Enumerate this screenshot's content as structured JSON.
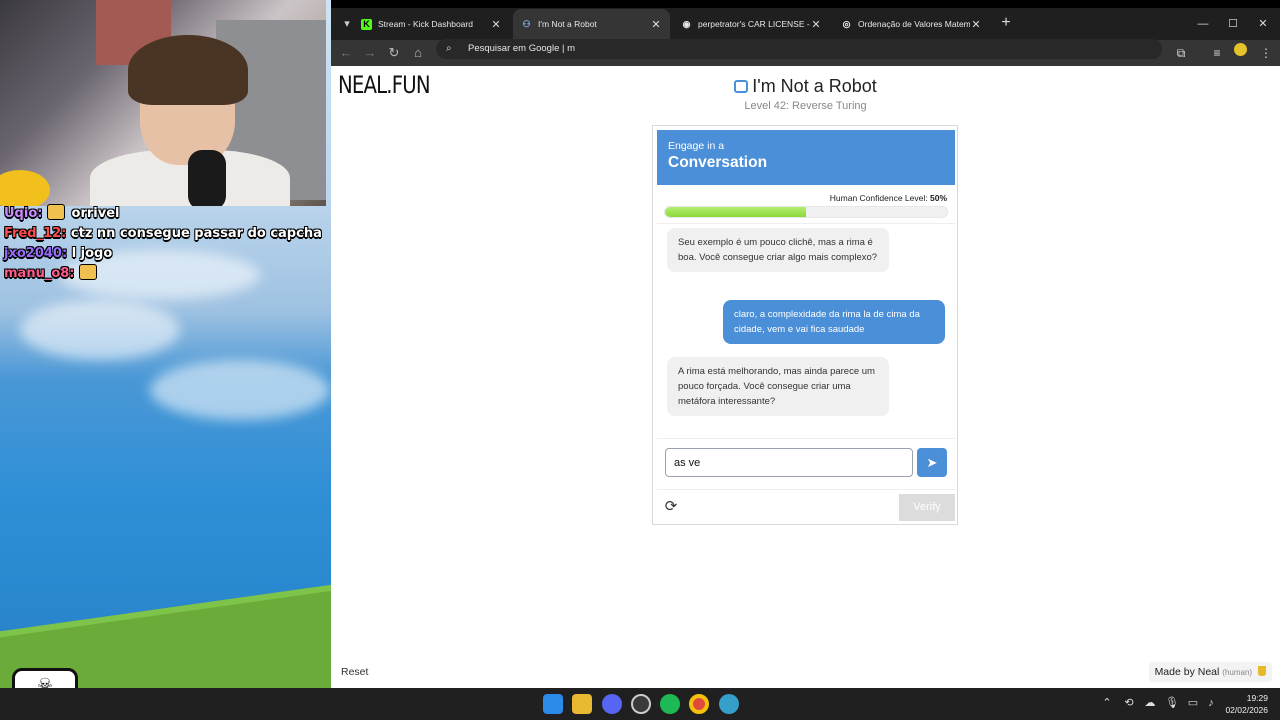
{
  "stream": {
    "chat": [
      {
        "user": "Uqio:",
        "user_color": "#c78bff",
        "text": "orrivel",
        "has_emote": true
      },
      {
        "user": "Fred_12:",
        "user_color": "#ff4d4d",
        "text": "ctz nn consegue passar do capcha",
        "has_emote": false
      },
      {
        "user": "jxo2040:",
        "user_color": "#9b6bff",
        "text": "l jogo",
        "has_emote": false
      },
      {
        "user": "manu_o8:",
        "user_color": "#ff5a8a",
        "text": "",
        "has_emote": true
      }
    ]
  },
  "browser": {
    "tabs": [
      {
        "title": "Stream - Kick Dashboard",
        "favicon_color": "#53fc18",
        "favicon_glyph": "K",
        "active": false
      },
      {
        "title": "I'm Not a Robot",
        "favicon_color": "#8ab4f8",
        "favicon_glyph": "⚇",
        "active": true
      },
      {
        "title": "perpetrator's CAR LICENSE - Pe",
        "favicon_color": "#e8e8e8",
        "favicon_glyph": "◉",
        "active": false
      },
      {
        "title": "Ordenação de Valores Matemát",
        "favicon_color": "#e8e8e8",
        "favicon_glyph": "◎",
        "active": false
      }
    ],
    "omnibox_text": "Pesquisar em Google  |  m"
  },
  "page": {
    "brand": "NEAL.FUN",
    "title": "I'm Not a Robot",
    "level": "Level 42: Reverse Turing",
    "captcha": {
      "header_small": "Engage in a",
      "header_big": "Conversation",
      "confidence_label": "Human Confidence Level:",
      "confidence_value": "50%",
      "confidence_fraction": 0.5,
      "messages": [
        {
          "from": "bot",
          "text": "Seu exemplo é um pouco clichê, mas a rima é boa. Você consegue criar algo mais complexo?"
        },
        {
          "from": "user",
          "text": "claro, a complexidade da rima la de cima da cidade, vem e vai fica saudade"
        },
        {
          "from": "bot",
          "text": "A rima está melhorando, mas ainda parece um pouco forçada. Você consegue criar uma metáfora interessante?"
        }
      ],
      "input_value": "as ve",
      "verify_label": "Verify"
    },
    "reset_label": "Reset",
    "made_by": "Made by Neal",
    "made_by_tag": "(human)"
  },
  "taskbar": {
    "time": "19:29",
    "date": "02/02/2026"
  },
  "colors": {
    "accent": "#4a8fd8",
    "progress": "#89d93a"
  }
}
